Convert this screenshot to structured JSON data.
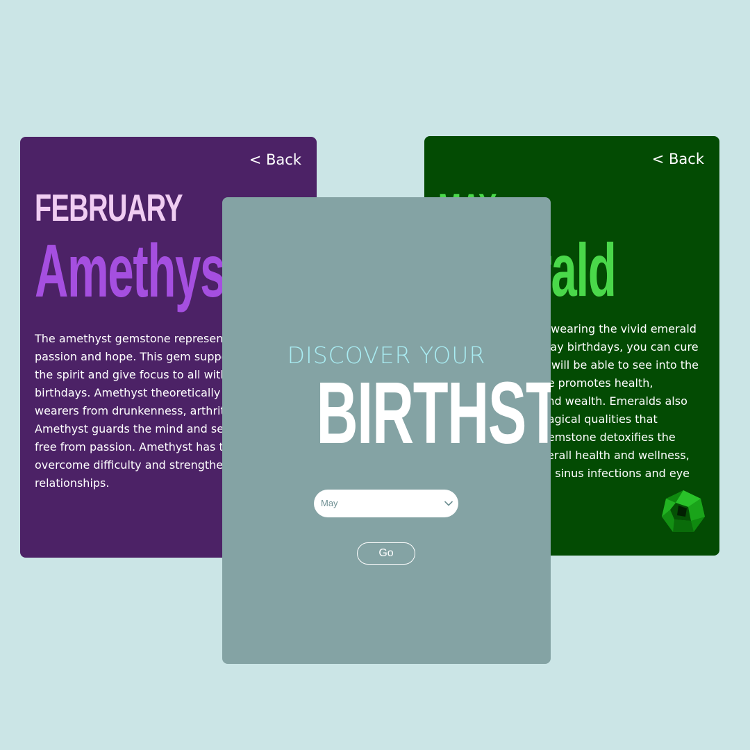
{
  "background_color": "#cbe5e6",
  "left_card": {
    "back_label": "< Back",
    "month": "FEBRUARY",
    "stone": "Amethyst",
    "description": [
      "The amethyst gemstone represents",
      "passion and hope. This gem supports",
      "the spirit and give focus to all with",
      "birthdays. Amethyst theoretically protects",
      "wearers from drunkenness, arthritis",
      "Amethyst guards the mind and sets",
      "free from passion. Amethyst has the",
      "overcome difficulty and strengthen",
      "relationships."
    ],
    "colors": {
      "background": "#4c2266",
      "month": "#f0cdf2",
      "stone": "#a54fe0"
    }
  },
  "right_card": {
    "back_label": "< Back",
    "month": "MAY",
    "stone": "Emerald",
    "description": [
      "y wearing the vivid emerald",
      "May birthdays, you can cure",
      "d will be able to see into the",
      "ne promotes health,",
      "and wealth. Emeralds also",
      "nagical qualities that",
      "gemstone detoxifies the",
      "verall health and wellness,",
      "m sinus infections and eye"
    ],
    "gem_icon": "emerald-gem-icon",
    "colors": {
      "background": "#034b03",
      "text": "#4ad84a"
    }
  },
  "main_card": {
    "heading_small": "DISCOVER YOUR",
    "heading_large": "BIRTHSTONE",
    "select": {
      "selected": "May"
    },
    "go_label": "Go",
    "colors": {
      "background": "#84a3a4",
      "heading_small": "#a9ecf2"
    }
  }
}
